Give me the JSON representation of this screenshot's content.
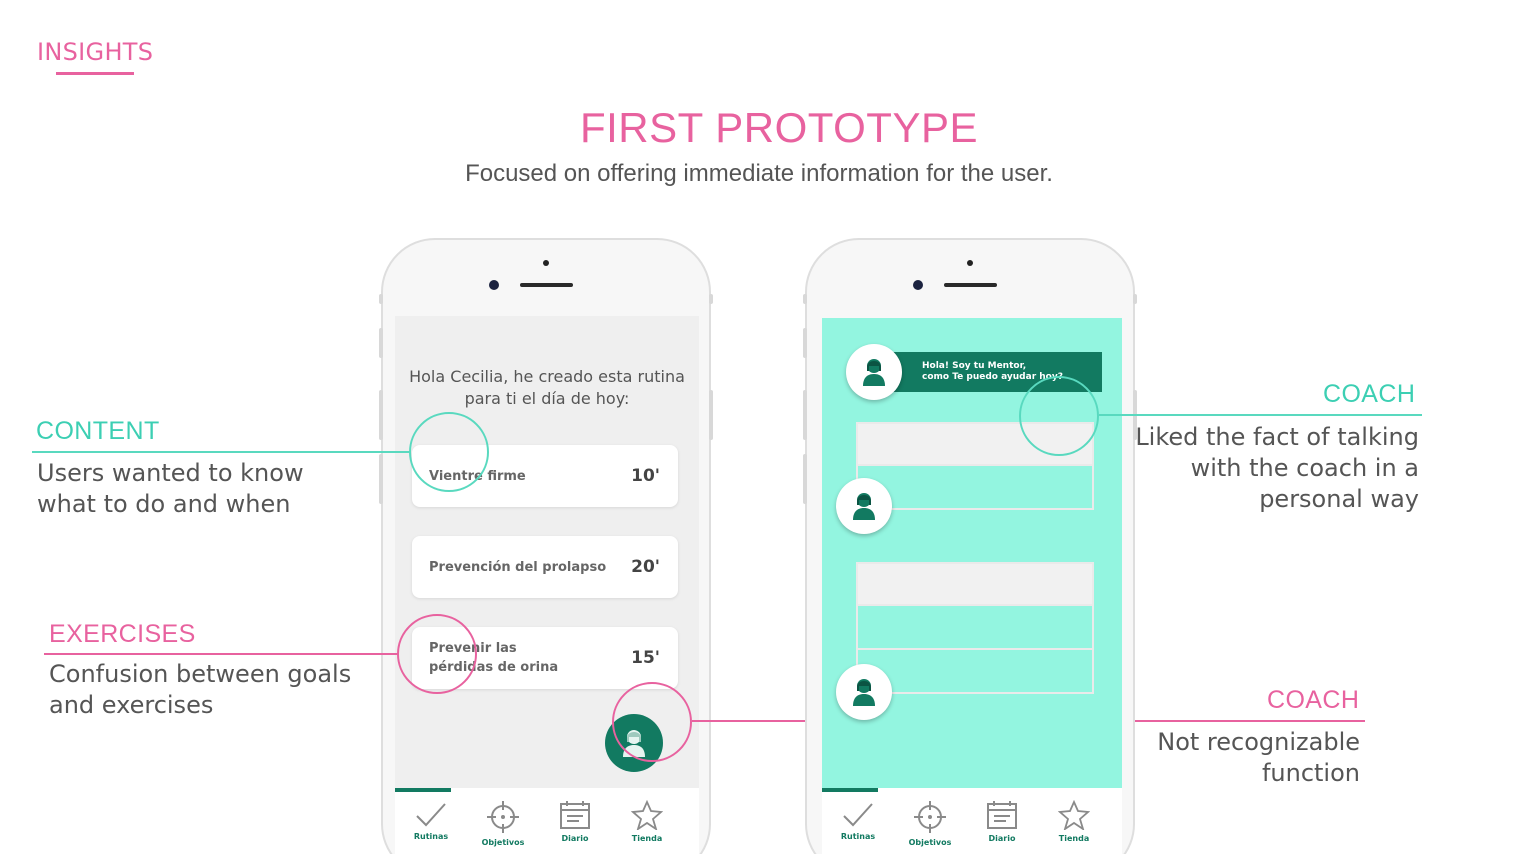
{
  "header": {
    "section": "INSIGHTS",
    "title": "FIRST PROTOTYPE",
    "subtitle": "Focused on offering immediate information for the user."
  },
  "colors": {
    "pink": "#e8629f",
    "teal": "#59d9bf",
    "mint": "#93f5e0",
    "green": "#127a61"
  },
  "annotations": {
    "content": {
      "label": "CONTENT",
      "note_line1": "Users wanted to know",
      "note_line2": "what to do and when"
    },
    "exercises": {
      "label": "EXERCISES",
      "note_line1": "Confusion between goals",
      "note_line2": "and exercises"
    },
    "coach_top": {
      "label": "COACH",
      "note_line1": "Liked the fact of talking",
      "note_line2": "with the coach  in a",
      "note_line3": "personal way"
    },
    "coach_bottom": {
      "label": "COACH",
      "note_line1": "Not recognizable",
      "note_line2": "function"
    }
  },
  "phone1": {
    "greeting_line1": "Hola Cecilia, he creado esta rutina",
    "greeting_line2": "para ti el día de hoy:",
    "routines": [
      {
        "name_line1": "Vientre firme",
        "name_line2": "",
        "minutes": "10'"
      },
      {
        "name_line1": "Prevención del prolapso",
        "name_line2": "",
        "minutes": "20'"
      },
      {
        "name_line1": "Prevenir las",
        "name_line2": "pérdidas de orina",
        "minutes": "15'"
      }
    ],
    "fab_icon": "coach-avatar-icon"
  },
  "phone2": {
    "coach_message_line1": "Hola! Soy tu Mentor,",
    "coach_message_line2": "como Te puedo ayudar hoy?"
  },
  "tabs": [
    {
      "label": "Rutinas",
      "icon": "check-icon"
    },
    {
      "label": "Objetivos",
      "icon": "target-icon"
    },
    {
      "label": "Diario",
      "icon": "calendar-icon"
    },
    {
      "label": "Tienda",
      "icon": "star-icon"
    }
  ]
}
